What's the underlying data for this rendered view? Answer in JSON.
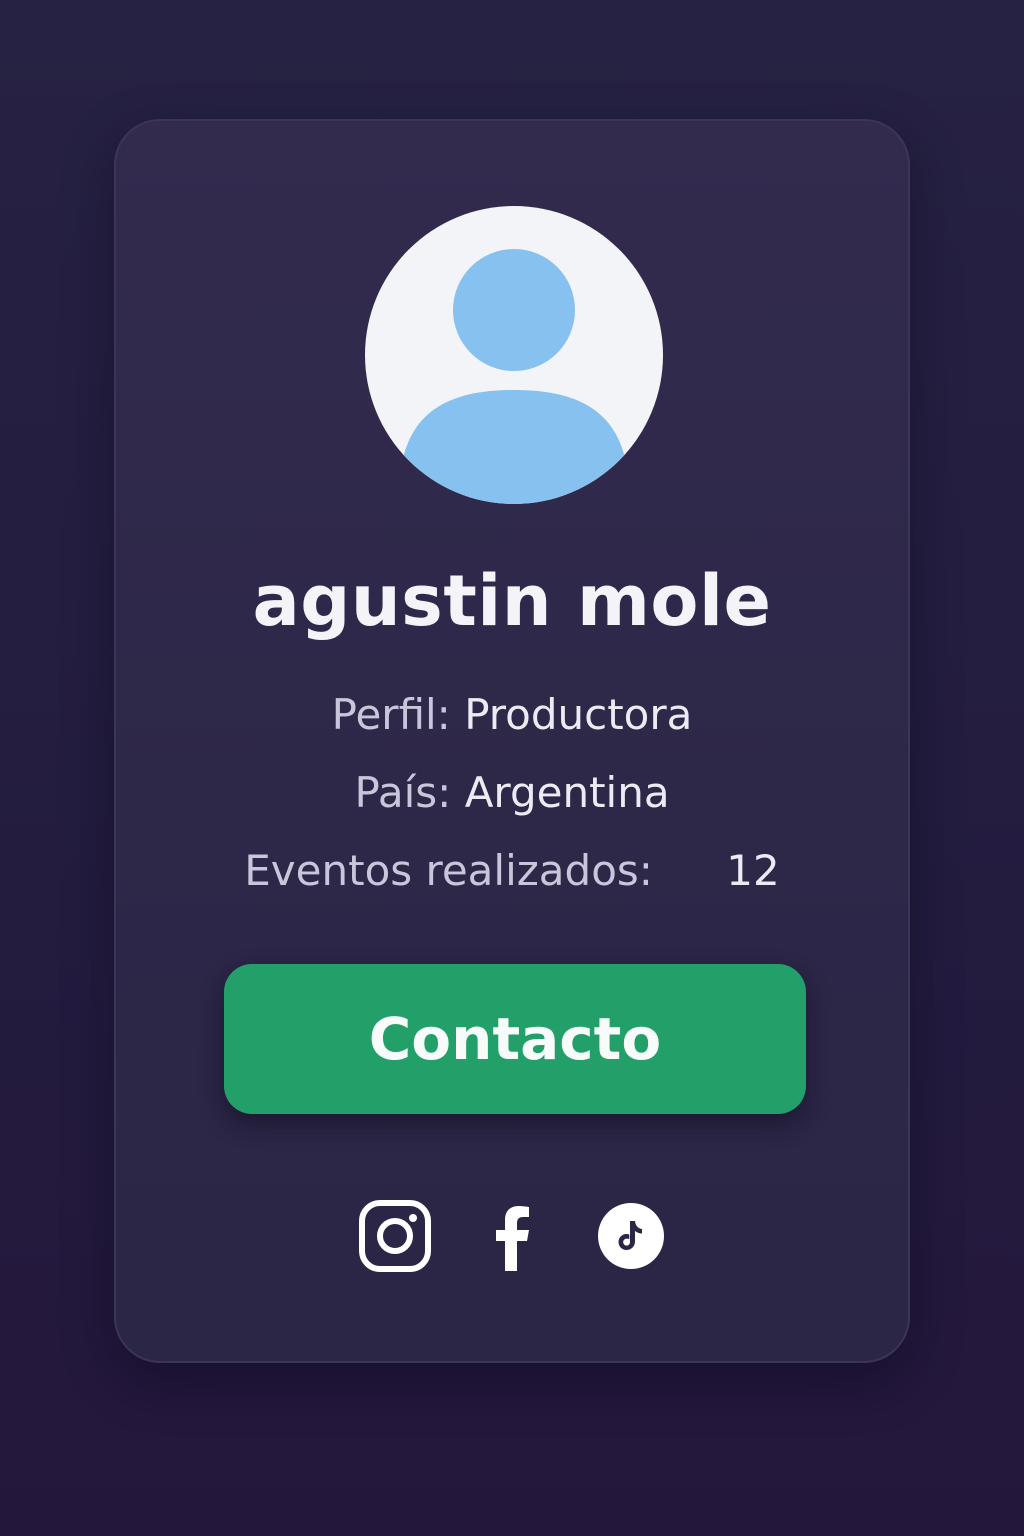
{
  "profile": {
    "name": "agustin mole",
    "avatar_icon": "user-avatar-icon",
    "rows": [
      {
        "label": "Perfil:",
        "value": "Productora"
      },
      {
        "label": "País:",
        "value": "Argentina"
      },
      {
        "label": "Eventos realizados:",
        "value": "12"
      }
    ]
  },
  "actions": {
    "contact_label": "Contacto"
  },
  "social": [
    {
      "icon": "instagram-icon"
    },
    {
      "icon": "facebook-icon"
    },
    {
      "icon": "tiktok-icon"
    }
  ],
  "colors": {
    "background": "#241d40",
    "card": "#2f294b",
    "accent_green": "#23a069",
    "avatar_blue": "#86c1ef",
    "avatar_bg": "#f3f4f8",
    "text_primary": "#f4f3f8",
    "text_secondary": "#c9c5da"
  }
}
